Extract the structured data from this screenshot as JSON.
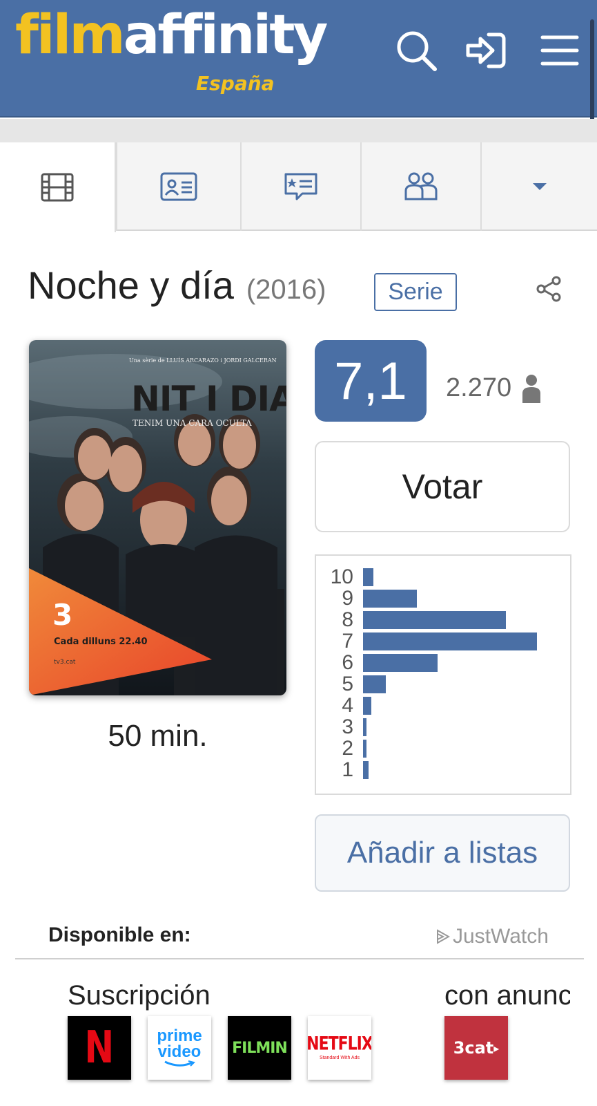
{
  "header": {
    "logo_part1": "film",
    "logo_part2": "affinity",
    "logo_sub": "España",
    "icons": [
      "search-icon",
      "login-icon",
      "menu-icon"
    ]
  },
  "tabs": [
    {
      "icon": "film-icon",
      "active": true
    },
    {
      "icon": "id-card-icon"
    },
    {
      "icon": "review-icon"
    },
    {
      "icon": "users-icon"
    },
    {
      "icon": "dropdown-caret-icon"
    }
  ],
  "movie": {
    "title": "Noche y día",
    "year": "(2016)",
    "badge": "Serie",
    "duration": "50 min.",
    "rating": "7,1",
    "votes": "2.270",
    "vote_label": "Votar",
    "lists_label": "Añadir a listas"
  },
  "poster": {
    "credit": "Una sèrie de LLUÍS ARCARAZO i JORDI GALCERAN",
    "title": "NIT  I  DIA",
    "tagline": "TENIM UNA CARA OCULTA",
    "channel": "3",
    "schedule": "Cada dilluns 22.40",
    "site": "tv3.cat"
  },
  "histogram": {
    "labels": [
      "10",
      "9",
      "8",
      "7",
      "6",
      "5",
      "4",
      "3",
      "2",
      "1"
    ],
    "values": [
      5,
      26,
      69,
      84,
      36,
      11,
      4,
      1.5,
      1.5,
      2.5
    ],
    "max": 100,
    "color": "#4a6fa5"
  },
  "availability": {
    "title": "Disponible en:",
    "source": "JustWatch",
    "subscription_label": "Suscripción",
    "ads_label": "con anunc",
    "providers": [
      {
        "name": "Netflix",
        "letter": "N"
      },
      {
        "name": "Prime Video",
        "line1": "prime",
        "line2": "video"
      },
      {
        "name": "Filmin",
        "text": "FILMIN"
      },
      {
        "name": "Netflix Standard with Ads",
        "text": "NETFLIX",
        "sub": "Standard With Ads"
      },
      {
        "name": "3cat",
        "text": "3cat"
      }
    ]
  },
  "colors": {
    "brand": "#4a6fa5",
    "logo_yellow": "#f3c221"
  }
}
